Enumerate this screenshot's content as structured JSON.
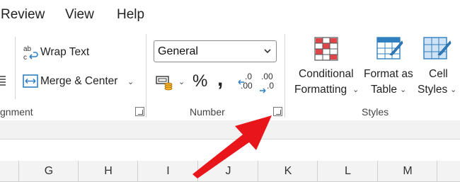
{
  "menu": {
    "items": [
      "Review",
      "View",
      "Help"
    ]
  },
  "ribbon": {
    "alignment": {
      "group_label": "gnment",
      "wrap_text_label": "Wrap Text",
      "merge_center_label": "Merge & Center"
    },
    "number": {
      "group_label": "Number",
      "format_value": "General",
      "percent_symbol": "%",
      "comma_symbol": ",",
      "increase_decimal_top": ".0",
      "increase_decimal_bottom": ".00",
      "decrease_decimal_top": ".00",
      "decrease_decimal_bottom": ".0"
    },
    "styles": {
      "group_label": "Styles",
      "conditional_formatting_line1": "Conditional",
      "conditional_formatting_line2": "Formatting",
      "format_as_table_line1": "Format as",
      "format_as_table_line2": "Table",
      "cell_styles_line1": "Cell",
      "cell_styles_line2": "Styles"
    }
  },
  "grid": {
    "columns": [
      "G",
      "H",
      "I",
      "J",
      "K",
      "L",
      "M"
    ]
  },
  "colors": {
    "annotation_arrow": "#e8151b",
    "ribbon_blue": "#2f7fc1",
    "cf_red": "#e0454a"
  }
}
